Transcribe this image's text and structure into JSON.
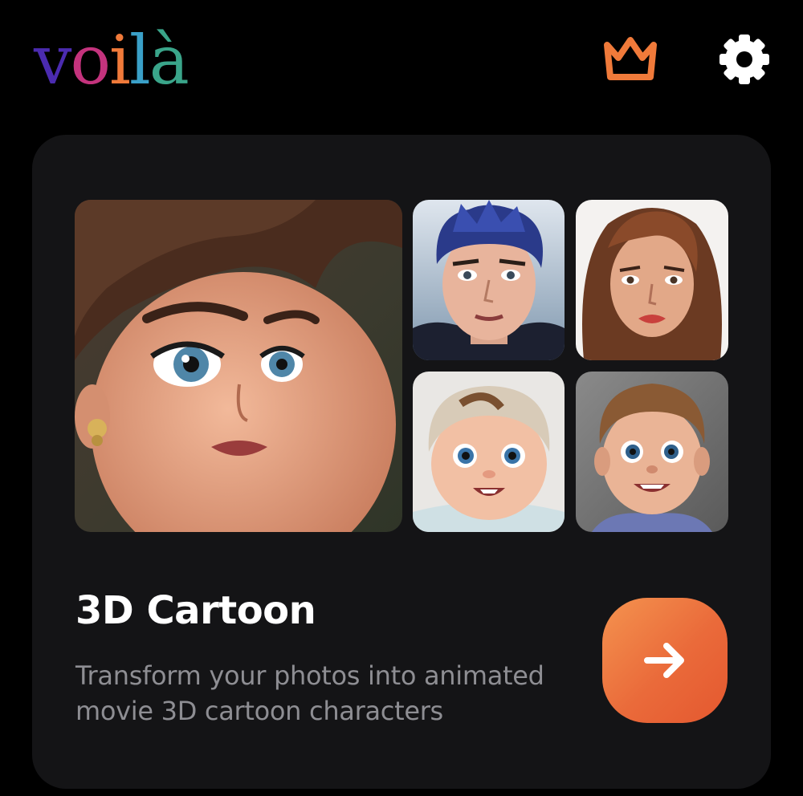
{
  "header": {
    "logo": {
      "letters": [
        "v",
        "o",
        "i",
        "l",
        "à"
      ],
      "colors": [
        "#4b2bb0",
        "#c4337d",
        "#f07a3a",
        "#3aa0c8",
        "#3aa58a"
      ]
    },
    "premium_icon": "crown-icon",
    "premium_color": "#f07a3a",
    "settings_icon": "gear-icon",
    "settings_color": "#ffffff"
  },
  "card": {
    "background": "#141416",
    "images": [
      {
        "name": "cartoon-woman-portrait",
        "icon": "woman-cartoon-image"
      },
      {
        "name": "cartoon-man-portrait",
        "icon": "man-cartoon-image"
      },
      {
        "name": "cartoon-brunette-portrait",
        "icon": "woman-cartoon-image"
      },
      {
        "name": "cartoon-baby-portrait",
        "icon": "baby-cartoon-image"
      },
      {
        "name": "cartoon-boy-portrait",
        "icon": "boy-cartoon-image"
      }
    ],
    "title": "3D Cartoon",
    "description": "Transform your photos into animated movie 3D cartoon characters",
    "action": {
      "icon": "arrow-right-icon",
      "color": "#ea6a3a"
    }
  }
}
